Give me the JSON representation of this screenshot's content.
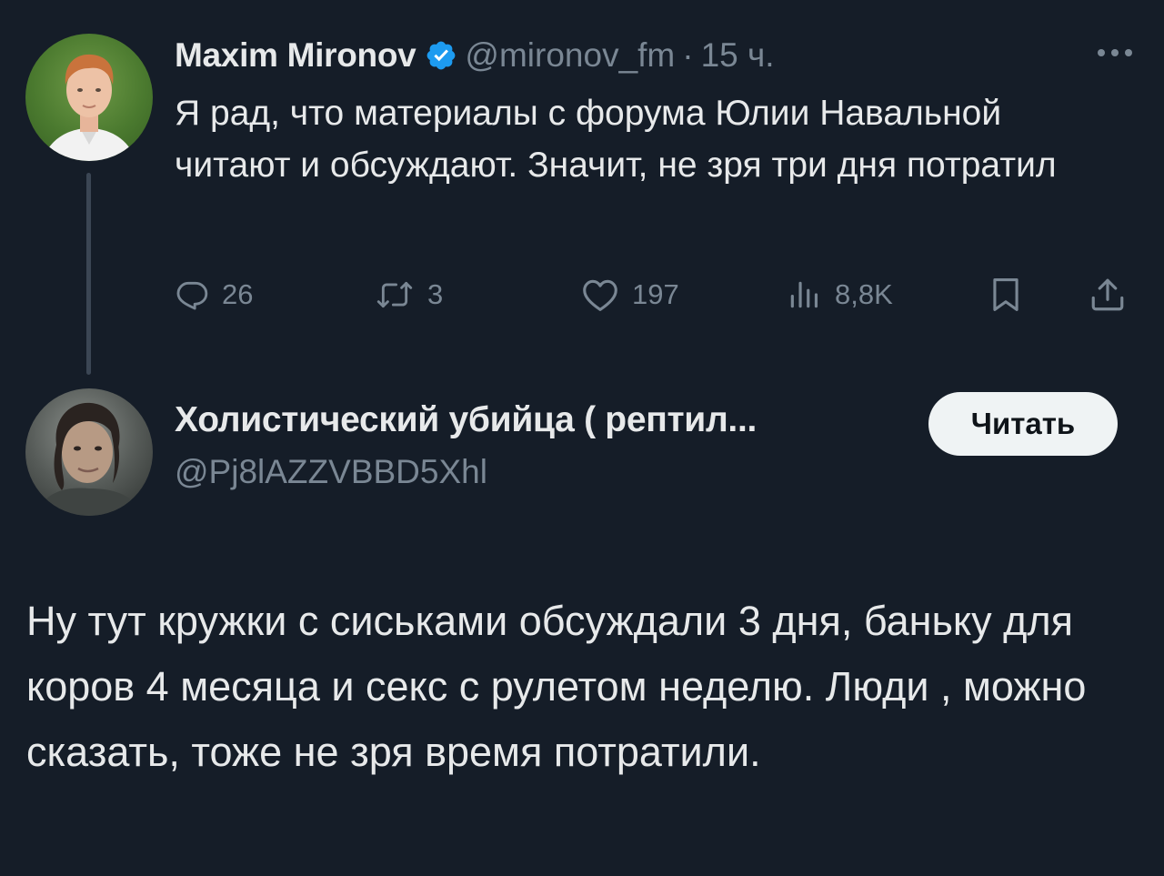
{
  "parent_tweet": {
    "author_name": "Maxim Mironov",
    "verified": true,
    "handle": "@mironov_fm",
    "separator": "·",
    "time": "15 ч.",
    "text": "Я рад, что материалы с форума Юлии Навальной читают и обсуждают. Значит, не зря три дня потратил",
    "actions": {
      "replies": "26",
      "reposts": "3",
      "likes": "197",
      "views": "8,8K"
    },
    "icons": {
      "more": "more-dots-icon",
      "reply": "reply-bubble-icon",
      "repost": "repost-icon",
      "like": "heart-icon",
      "views": "views-bars-icon",
      "bookmark": "bookmark-icon",
      "share": "share-icon"
    }
  },
  "reply": {
    "author_name": "Холистический убийца ( рептил...",
    "handle": "@Pj8lAZZVBBD5Xhl",
    "follow_label": "Читать",
    "text": "Ну тут кружки с сиськами обсуждали 3 дня, баньку для коров 4 месяца и секс с рулетом неделю. Люди , можно сказать, тоже не зря время потратили."
  },
  "colors": {
    "background": "#151d28",
    "primary_text": "#e7e9ea",
    "secondary_text": "#7a8794",
    "verified_badge": "#1d9bf0",
    "follow_button_bg": "#eff3f4"
  }
}
